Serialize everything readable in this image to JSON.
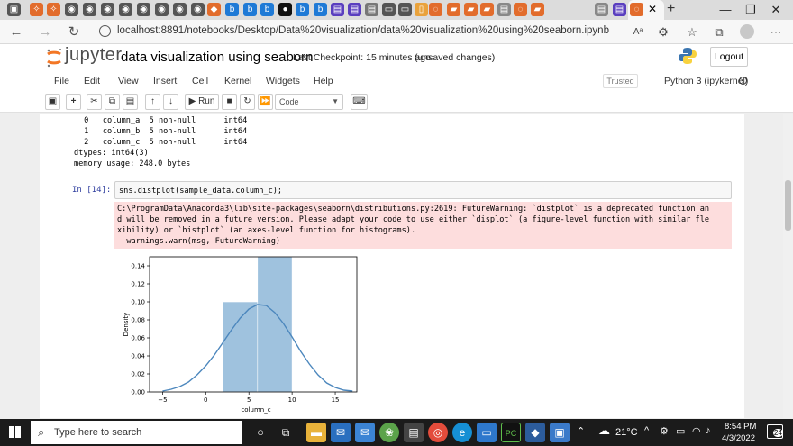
{
  "browser": {
    "address": "localhost:8891/notebooks/Desktop/Data%20visualization/data%20visualization%20using%20seaborn.ipynb",
    "reader_label": "Aᵃ"
  },
  "jupyter": {
    "logo_text": "jupyter",
    "notebook_title": "data visualization using seaborn",
    "checkpoint": "Last Checkpoint: 15 minutes ago",
    "save_status": "(unsaved changes)",
    "logout_label": "Logout",
    "menu": [
      "File",
      "Edit",
      "View",
      "Insert",
      "Cell",
      "Kernel",
      "Widgets",
      "Help"
    ],
    "trusted_label": "Trusted",
    "kernel_name": "Python 3 (ipykernel)",
    "run_label": "Run",
    "cell_type": "Code"
  },
  "notebook": {
    "previous_output": [
      " 0   column_a  5 non-null      int64",
      " 1   column_b  5 non-null      int64",
      " 2   column_c  5 non-null      int64",
      "dtypes: int64(3)",
      "memory usage: 248.0 bytes"
    ],
    "prompt": "In [14]:",
    "code": "sns.distplot(sample_data.column_c);",
    "stderr": [
      "C:\\ProgramData\\Anaconda3\\lib\\site-packages\\seaborn\\distributions.py:2619: FutureWarning: `distplot` is a deprecated function an",
      "d will be removed in a future version. Please adapt your code to use either `displot` (a figure-level function with similar fle",
      "xibility) or `histplot` (an axes-level function for histograms).",
      "  warnings.warn(msg, FutureWarning)"
    ]
  },
  "chart_data": {
    "type": "bar",
    "xlabel": "column_c",
    "ylabel": "Density",
    "xlim": [
      -6.5,
      17.5
    ],
    "ylim": [
      0,
      0.15
    ],
    "xticks": [
      -5,
      0,
      5,
      10,
      15
    ],
    "xtick_labels": [
      "−5",
      "0",
      "5",
      "10",
      "15"
    ],
    "yticks": [
      0.0,
      0.02,
      0.04,
      0.06,
      0.08,
      0.1,
      0.12,
      0.14
    ],
    "ytick_labels": [
      "0.00",
      "0.02",
      "0.04",
      "0.06",
      "0.08",
      "0.10",
      "0.12",
      "0.14"
    ],
    "bars": [
      {
        "x0": 2,
        "x1": 6,
        "height": 0.1
      },
      {
        "x0": 6,
        "x1": 10,
        "height": 0.15
      }
    ],
    "kde_x": [
      -5,
      -4,
      -3,
      -2,
      -1,
      0,
      1,
      2,
      3,
      4,
      5,
      6,
      7,
      8,
      9,
      10,
      11,
      12,
      13,
      14,
      15,
      16,
      17
    ],
    "kde_y": [
      0.001,
      0.003,
      0.006,
      0.011,
      0.019,
      0.029,
      0.041,
      0.055,
      0.069,
      0.082,
      0.092,
      0.097,
      0.096,
      0.088,
      0.076,
      0.061,
      0.045,
      0.031,
      0.019,
      0.01,
      0.005,
      0.002,
      0.001
    ],
    "bar_color": "#9fc2de",
    "line_color": "#4c87bd"
  },
  "taskbar": {
    "search_placeholder": "Type here to search",
    "weather": "21°C",
    "time": "8:54 PM",
    "date": "4/3/2022",
    "notifications": "24"
  }
}
